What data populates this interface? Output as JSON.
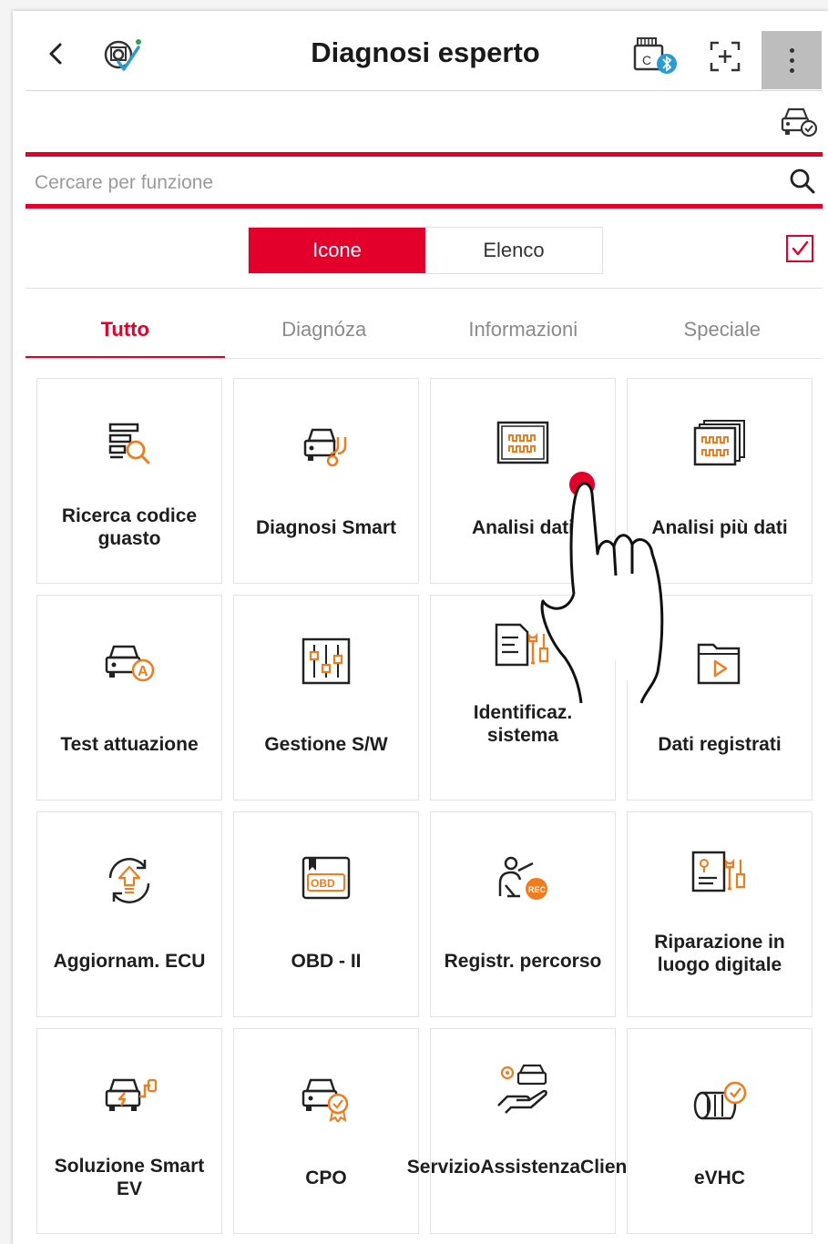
{
  "header": {
    "title": "Diagnosi esperto",
    "back_icon": "chevron-left-icon",
    "status_icon": "vehicle-check-icon",
    "vci_icon": "vci-bluetooth-icon",
    "vci_label": "C",
    "scan_icon": "scan-add-icon",
    "scan_label": "[+]",
    "more_icon": "more-vertical-icon",
    "car_clock_icon": "car-clock-icon"
  },
  "search": {
    "placeholder": "Cercare per funzione",
    "icon": "search-icon"
  },
  "view_toggle": {
    "options": [
      "Icone",
      "Elenco"
    ],
    "selected": "Icone",
    "checkbox_checked": true
  },
  "tabs": [
    {
      "label": "Tutto",
      "active": true
    },
    {
      "label": "Diagnóza",
      "active": false
    },
    {
      "label": "Informazioni",
      "active": false
    },
    {
      "label": "Speciale",
      "active": false
    }
  ],
  "tiles": [
    {
      "label": "Ricerca codice guasto",
      "icon": "fault-code-search-icon"
    },
    {
      "label": "Diagnosi Smart",
      "icon": "smart-diagnosis-icon"
    },
    {
      "label": "Analisi dati",
      "icon": "data-analysis-icon"
    },
    {
      "label": "Analisi più dati",
      "icon": "multi-data-analysis-icon"
    },
    {
      "label": "Test attuazione",
      "icon": "actuation-test-icon",
      "badge": "A"
    },
    {
      "label": "Gestione S/W",
      "icon": "software-management-icon"
    },
    {
      "label": "Identificaz. sistema",
      "icon": "system-identification-icon"
    },
    {
      "label": "Dati registrati",
      "icon": "recorded-data-icon"
    },
    {
      "label": "Aggiornam. ECU",
      "icon": "ecu-update-icon"
    },
    {
      "label": "OBD - II",
      "icon": "obd-icon",
      "badge": "OBD"
    },
    {
      "label": "Registr. percorso",
      "icon": "route-recording-icon",
      "badge": "REC"
    },
    {
      "label": "Riparazione in luogo digitale",
      "icon": "digital-repair-icon"
    },
    {
      "label": "Soluzione Smart EV",
      "icon": "ev-solution-icon"
    },
    {
      "label": "CPO",
      "icon": "cpo-icon"
    },
    {
      "label": "ServizioAssistenzaClienti",
      "icon": "customer-service-icon"
    },
    {
      "label": "eVHC",
      "icon": "evhc-icon"
    }
  ],
  "colors": {
    "accent": "#e3002b",
    "icon_orange": "#f07c1c",
    "text": "#1e1e1e",
    "muted": "#8a8a8a"
  },
  "overlay": {
    "icon": "tap-hand-icon"
  }
}
